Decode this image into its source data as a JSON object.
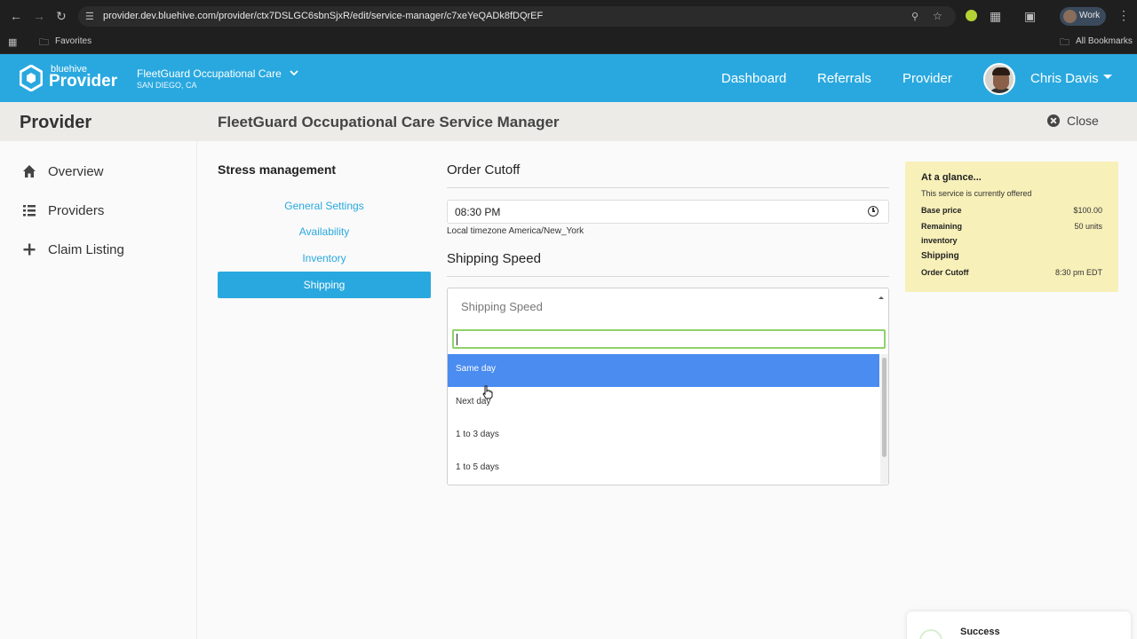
{
  "browser": {
    "url": "provider.dev.bluehive.com/provider/ctx7DSLGC6sbnSjxR/edit/service-manager/c7xeYeQADk8fDQrEF",
    "profile_label": "Work",
    "bookmarks_favorites": "Favorites",
    "bookmarks_all": "All Bookmarks"
  },
  "header": {
    "logo_small": "bluehive",
    "logo_big": "Provider",
    "org_name": "FleetGuard Occupational Care",
    "org_location": "SAN DIEGO, CA",
    "nav": [
      "Dashboard",
      "Referrals",
      "Provider"
    ],
    "user_name": "Chris Davis",
    "brand_color": "#29a8df"
  },
  "sidebar": {
    "title": "Provider",
    "items": [
      {
        "label": "Overview",
        "icon": "home-icon"
      },
      {
        "label": "Providers",
        "icon": "list-icon"
      },
      {
        "label": "Claim Listing",
        "icon": "plus-icon"
      }
    ]
  },
  "main": {
    "title": "FleetGuard Occupational Care Service Manager",
    "close_label": "Close"
  },
  "service": {
    "name": "Stress management",
    "tabs": [
      {
        "label": "General Settings",
        "active": false
      },
      {
        "label": "Availability",
        "active": false
      },
      {
        "label": "Inventory",
        "active": false
      },
      {
        "label": "Shipping",
        "active": true
      }
    ]
  },
  "form": {
    "order_cutoff_label": "Order Cutoff",
    "order_cutoff_value": "08:30 PM",
    "timezone_note": "Local timezone America/New_York",
    "shipping_speed_label": "Shipping Speed",
    "shipping_speed_placeholder": "Shipping Speed",
    "search_value": "",
    "options": [
      "Same day",
      "Next day",
      "1 to 3 days",
      "1 to 5 days"
    ],
    "highlighted_option": "Same day"
  },
  "glance": {
    "title": "At a glance...",
    "subtitle": "This service is currently offered",
    "base_price_label": "Base price",
    "base_price_value": "$100.00",
    "remaining_label_1": "Remaining",
    "remaining_label_2": "inventory",
    "remaining_value": "50 units",
    "shipping_heading": "Shipping",
    "order_cutoff_label": "Order Cutoff",
    "order_cutoff_value": "8:30 pm EDT"
  },
  "toast": {
    "title": "Success"
  }
}
